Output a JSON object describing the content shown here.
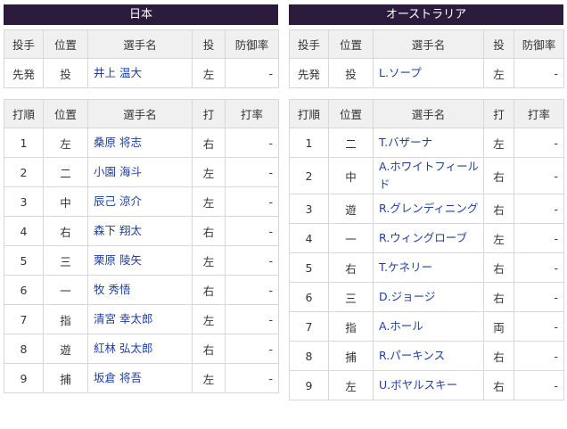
{
  "japan": {
    "title": "日本",
    "pitcher_headers": [
      "投手",
      "位置",
      "選手名",
      "投",
      "防御率"
    ],
    "pitcher": {
      "role": "先発",
      "pos": "投",
      "name": "井上 温大",
      "throws": "左",
      "era": "-"
    },
    "batter_headers": [
      "打順",
      "位置",
      "選手名",
      "打",
      "打率"
    ],
    "batters": [
      {
        "order": "1",
        "pos": "左",
        "name": "桑原 将志",
        "bats": "右",
        "avg": "-"
      },
      {
        "order": "2",
        "pos": "二",
        "name": "小園 海斗",
        "bats": "左",
        "avg": "-"
      },
      {
        "order": "3",
        "pos": "中",
        "name": "辰己 涼介",
        "bats": "左",
        "avg": "-"
      },
      {
        "order": "4",
        "pos": "右",
        "name": "森下 翔太",
        "bats": "右",
        "avg": "-"
      },
      {
        "order": "5",
        "pos": "三",
        "name": "栗原 陵矢",
        "bats": "左",
        "avg": "-"
      },
      {
        "order": "6",
        "pos": "一",
        "name": "牧 秀悟",
        "bats": "右",
        "avg": "-"
      },
      {
        "order": "7",
        "pos": "指",
        "name": "清宮 幸太郎",
        "bats": "左",
        "avg": "-"
      },
      {
        "order": "8",
        "pos": "遊",
        "name": "紅林 弘太郎",
        "bats": "右",
        "avg": "-"
      },
      {
        "order": "9",
        "pos": "捕",
        "name": "坂倉 将吾",
        "bats": "左",
        "avg": "-"
      }
    ]
  },
  "australia": {
    "title": "オーストラリア",
    "pitcher_headers": [
      "投手",
      "位置",
      "選手名",
      "投",
      "防御率"
    ],
    "pitcher": {
      "role": "先発",
      "pos": "投",
      "name": "L.ソープ",
      "throws": "左",
      "era": "-"
    },
    "batter_headers": [
      "打順",
      "位置",
      "選手名",
      "打",
      "打率"
    ],
    "batters": [
      {
        "order": "1",
        "pos": "二",
        "name": "T.バザーナ",
        "bats": "左",
        "avg": "-"
      },
      {
        "order": "2",
        "pos": "中",
        "name": "A.ホワイトフィールド",
        "bats": "右",
        "avg": "-"
      },
      {
        "order": "3",
        "pos": "遊",
        "name": "R.グレンディニング",
        "bats": "右",
        "avg": "-"
      },
      {
        "order": "4",
        "pos": "一",
        "name": "R.ウィングローブ",
        "bats": "左",
        "avg": "-"
      },
      {
        "order": "5",
        "pos": "右",
        "name": "T.ケネリー",
        "bats": "右",
        "avg": "-"
      },
      {
        "order": "6",
        "pos": "三",
        "name": "D.ジョージ",
        "bats": "右",
        "avg": "-"
      },
      {
        "order": "7",
        "pos": "指",
        "name": "A.ホール",
        "bats": "両",
        "avg": "-"
      },
      {
        "order": "8",
        "pos": "捕",
        "name": "R.パーキンス",
        "bats": "右",
        "avg": "-"
      },
      {
        "order": "9",
        "pos": "左",
        "name": "U.ボヤルスキー",
        "bats": "右",
        "avg": "-"
      }
    ]
  }
}
